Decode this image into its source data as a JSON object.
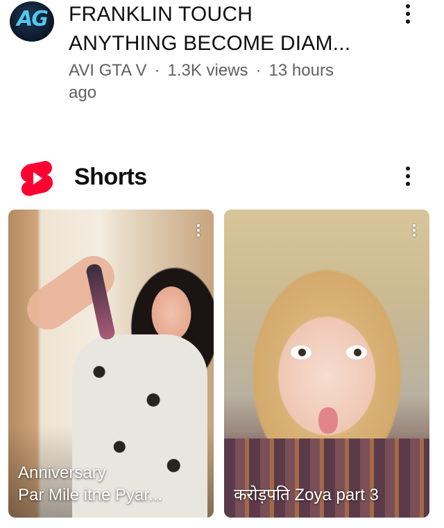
{
  "video": {
    "avatar_text": "AG",
    "title_line1": "FRANKLIN TOUCH",
    "title_line2": "ANYTHING BECOME DIAM...",
    "channel": "AVI GTA V",
    "views": "1.3K views",
    "time_line1": "13 hours",
    "time_line2": "ago",
    "separator": "·",
    "menu_icon": "more-vert-icon"
  },
  "shorts": {
    "header_title": "Shorts",
    "logo_icon": "youtube-shorts-icon",
    "logo_color": "#ff0033",
    "menu_icon": "more-vert-icon",
    "items": [
      {
        "title_line1": "Anniversary",
        "title_line2": "Par Mile itne Pyar..."
      },
      {
        "title_line1": "करोड़पति Zoya part 3"
      }
    ]
  },
  "colors": {
    "primary_text": "#0f0f0f",
    "secondary_text": "#606060",
    "accent": "#ff0033"
  }
}
